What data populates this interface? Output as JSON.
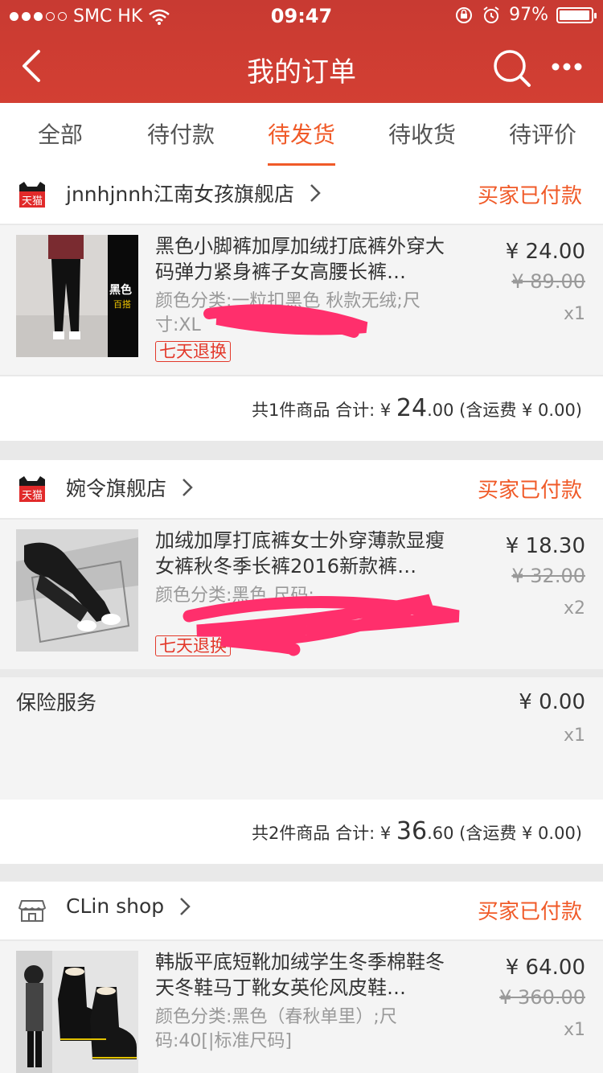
{
  "status_bar": {
    "carrier": "SMC HK",
    "time": "09:47",
    "battery": "97%",
    "battery_level": 0.97
  },
  "nav": {
    "title": "我的订单"
  },
  "tabs": [
    {
      "label": "全部"
    },
    {
      "label": "待付款"
    },
    {
      "label": "待发货"
    },
    {
      "label": "待收货"
    },
    {
      "label": "待评价"
    }
  ],
  "orders": [
    {
      "shop_name": "jnnhjnnh江南女孩旗舰店",
      "shop_badge": "天猫",
      "status": "买家已付款",
      "items": [
        {
          "title": "黑色小脚裤加厚加绒打底裤外穿大码弹力紧身裤子女高腰长裤…",
          "spec": "颜色分类:一粒扣黑色 秋款无绒;尺寸:XL",
          "thumb_text": "黑色",
          "thumb_text2": "百搭",
          "tag": "七天退换",
          "price": "¥ 24.00",
          "original_price": "¥ 89.00",
          "qty": "x1"
        }
      ],
      "total": {
        "prefix": "共1件商品 合计: ¥ ",
        "big": "24",
        "small": ".00",
        "shipping": " (含运费 ¥ 0.00)"
      }
    },
    {
      "shop_name": "婉令旗舰店",
      "shop_badge": "天猫",
      "status": "买家已付款",
      "items": [
        {
          "title": "加绒加厚打底裤女士外穿薄款显瘦女裤秋冬季长裤2016新款裤…",
          "spec": "颜色分类:黑色 尺码:",
          "tag": "七天退换",
          "price": "¥ 18.30",
          "original_price": "¥ 32.00",
          "qty": "x2"
        }
      ],
      "insurance": {
        "label": "保险服务",
        "price": "¥ 0.00",
        "qty": "x1"
      },
      "total": {
        "prefix": "共2件商品 合计: ¥ ",
        "big": "36",
        "small": ".60",
        "shipping": " (含运费 ¥ 0.00)"
      }
    },
    {
      "shop_name": "CLin shop",
      "status": "买家已付款",
      "items": [
        {
          "title": "韩版平底短靴加绒学生冬季棉鞋冬天冬鞋马丁靴女英伦风皮鞋…",
          "spec": "颜色分类:黑色（春秋单里）;尺码:40[|标准尺码]",
          "price": "¥ 64.00",
          "original_price": "¥ 360.00",
          "qty": "x1"
        }
      ]
    }
  ],
  "colors": {
    "header": "#d03c33",
    "accent": "#f05a28",
    "tag": "#e3392b",
    "scribble": "#ff2f6c"
  }
}
